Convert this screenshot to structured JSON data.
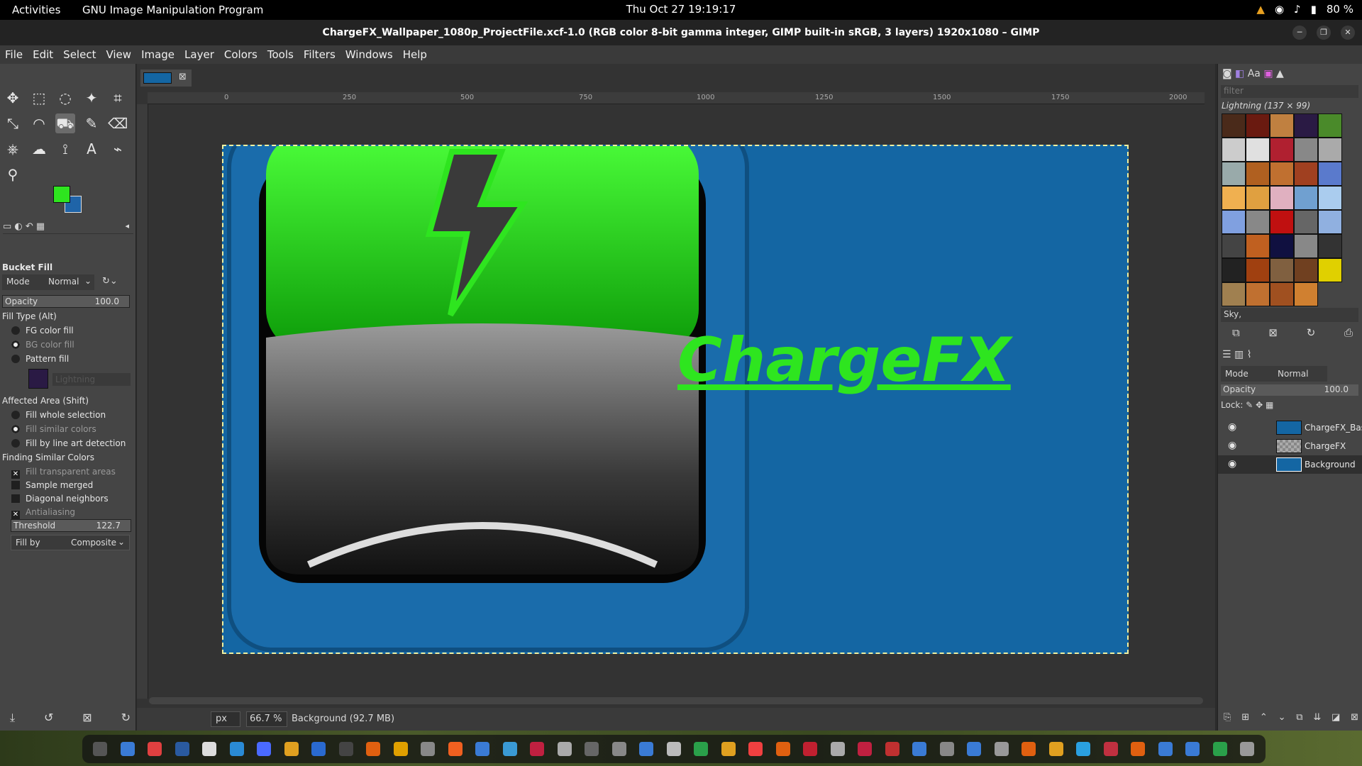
{
  "topbar": {
    "activities": "Activities",
    "app_name": "GNU Image Manipulation Program",
    "clock": "Thu Oct 27  19:19:17",
    "battery": "80 %"
  },
  "window": {
    "title": "ChargeFX_Wallpaper_1080p_ProjectFile.xcf-1.0 (RGB color 8-bit gamma integer, GIMP built-in sRGB, 3 layers) 1920x1080 – GIMP"
  },
  "menu": [
    "File",
    "Edit",
    "Select",
    "View",
    "Image",
    "Layer",
    "Colors",
    "Tools",
    "Filters",
    "Windows",
    "Help"
  ],
  "toolbox": {
    "tools": [
      "move-icon",
      "rect-select-icon",
      "lasso-icon",
      "fuzzy-select-icon",
      "crop-icon",
      "transform-icon",
      "warp-icon",
      "bucket-fill-icon",
      "pencil-icon",
      "eraser-icon",
      "clone-icon",
      "smudge-icon",
      "paths-icon",
      "text-icon",
      "color-picker-icon",
      "zoom-icon"
    ],
    "tool_glyphs": [
      "✥",
      "⬚",
      "◌",
      "✦",
      "⌗",
      "⤡",
      "◠",
      "⛟",
      "✎",
      "⌫",
      "⎈",
      "☁",
      "⟟",
      "A",
      "⌁",
      "⚲"
    ],
    "fg_color": "#2ee51f",
    "bg_color": "#1f64a8"
  },
  "tool_options": {
    "title": "Bucket Fill",
    "mode_label": "Mode",
    "mode_value": "Normal",
    "opacity_label": "Opacity",
    "opacity_value": "100.0",
    "fill_type_label": "Fill Type  (Alt)",
    "fill_types": [
      "FG color fill",
      "BG color fill",
      "Pattern fill"
    ],
    "pattern_name": "Lightning",
    "affected_label": "Affected Area  (Shift)",
    "affected": [
      "Fill whole selection",
      "Fill similar colors",
      "Fill by line art detection"
    ],
    "finding_label": "Finding Similar Colors",
    "finding": [
      "Fill transparent areas",
      "Sample merged",
      "Diagonal neighbors",
      "Antialiasing"
    ],
    "threshold_label": "Threshold",
    "threshold_value": "122.7",
    "fillby_label": "Fill by",
    "fillby_value": "Composite"
  },
  "ruler_marks": [
    "0",
    "250",
    "500",
    "750",
    "1000",
    "1250",
    "1500",
    "1750",
    "2000"
  ],
  "image": {
    "logo_text": "ChargeFX"
  },
  "status": {
    "unit": "px",
    "zoom": "66.7 %",
    "layer_info": "Background (92.7 MB)"
  },
  "patterns": {
    "filter_placeholder": "filter",
    "current": "Lightning (137 × 99)",
    "selected_name": "Sky,"
  },
  "layers": {
    "mode_label": "Mode",
    "mode_value": "Normal",
    "opacity_label": "Opacity",
    "opacity_value": "100.0",
    "lock_label": "Lock:",
    "items": [
      {
        "name": "ChargeFX_Bas"
      },
      {
        "name": "ChargeFX"
      },
      {
        "name": "Background"
      }
    ]
  }
}
